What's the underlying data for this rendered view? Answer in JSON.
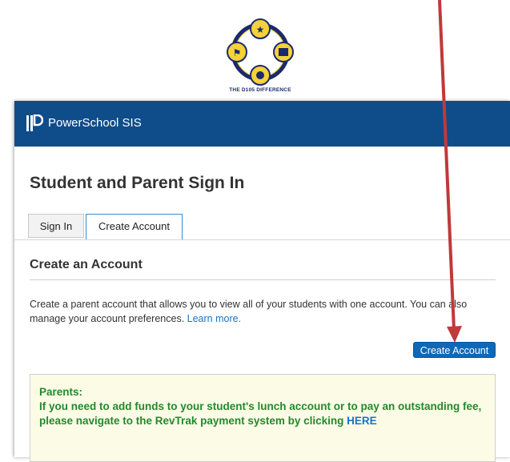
{
  "logo": {
    "caption": "THE D105 DIFFERENCE"
  },
  "header": {
    "brand": "PowerSchool SIS"
  },
  "page": {
    "title": "Student and Parent Sign In"
  },
  "tabs": [
    {
      "label": "Sign In",
      "active": false
    },
    {
      "label": "Create Account",
      "active": true
    }
  ],
  "section": {
    "title": "Create an Account",
    "description": "Create a parent account that allows you to view all of your students with one account. You can also manage your account preferences.",
    "learn_more": "Learn more."
  },
  "create_button": {
    "label": "Create Account"
  },
  "notice": {
    "heading": "Parents:",
    "body": "If you need to add funds to your student's lunch account or to pay an outstanding fee, please navigate to the RevTrak payment system by clicking",
    "link": "HERE"
  },
  "colors": {
    "banner": "#0f4c8a",
    "button": "#0f68b7",
    "notice_text": "#24892c",
    "link": "#1a73c8",
    "annotation_arrow": "#c0393b"
  }
}
